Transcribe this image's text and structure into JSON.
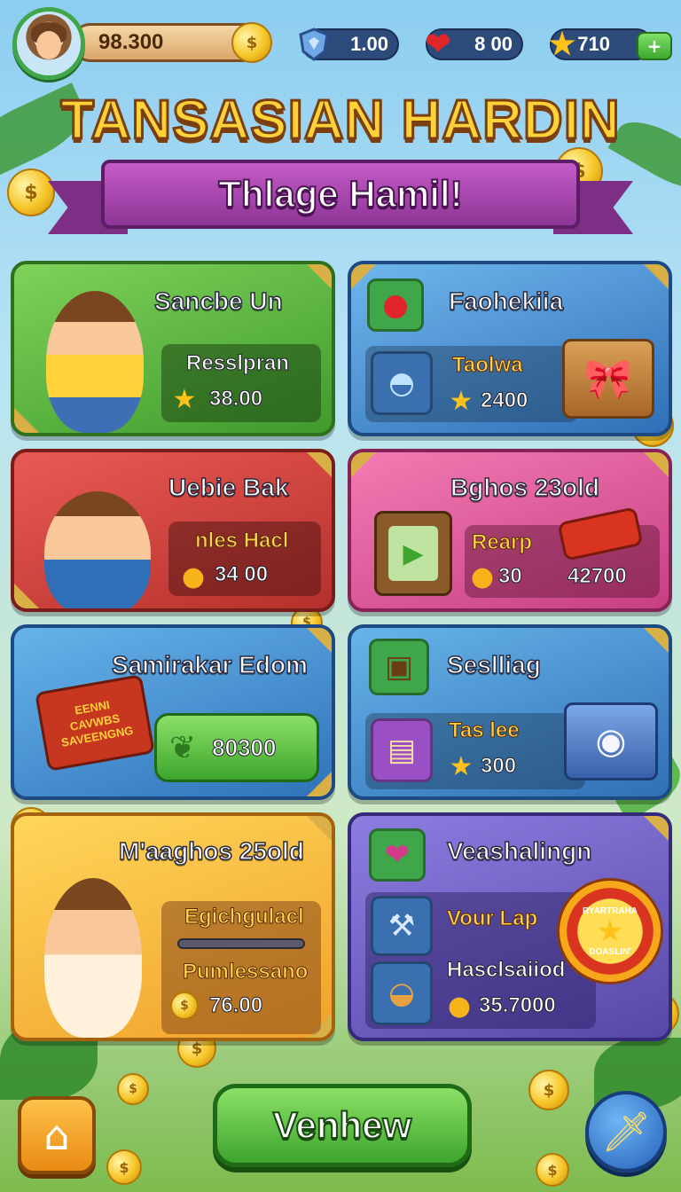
{
  "hud": {
    "coins": "98.300",
    "gems": "1.00",
    "hearts": "8 00",
    "stars": "710",
    "plus": "+"
  },
  "title": "TANSASIAN HARDIN",
  "banner": "Thlage Hamil!",
  "cards": [
    {
      "title": "Sancbe Un",
      "label": "Resslpran",
      "value": "38.00"
    },
    {
      "title": "Faohekiia",
      "label": "Taolwa",
      "value": "2400"
    },
    {
      "title": "Uebie Bak",
      "label": "nles Hacl",
      "value": "34 00"
    },
    {
      "title": "Bghos 23old",
      "label": "Rearp",
      "value": "30",
      "value2": "42700"
    },
    {
      "title": "Samirakar Edom",
      "value": "80300",
      "sign_lines": [
        "EENNI",
        "CAVWBS",
        "SAVEENGNG"
      ]
    },
    {
      "title": "Seslliag",
      "label": "Tas lee",
      "value": "300"
    },
    {
      "title": "M'aaghos 25old",
      "label": "Egichgulacl",
      "label2": "Pumlessano",
      "value": "76.00"
    },
    {
      "title": "Veashalingn",
      "label": "Vour Lap",
      "label2": "Hasclsaiiod",
      "value": "35.7000",
      "badge_lines": [
        "RYARTRAHA",
        "DOASLIN'"
      ]
    }
  ],
  "main_button": "Venhew",
  "colors": {
    "accent_gold": "#ffd23a",
    "banner_purple": "#8d3596",
    "button_green": "#3ea52d"
  },
  "icons": [
    "avatar",
    "coin-icon",
    "gem-shield-icon",
    "heart-icon",
    "star-icon",
    "plus-icon",
    "home-icon",
    "sword-icon"
  ]
}
